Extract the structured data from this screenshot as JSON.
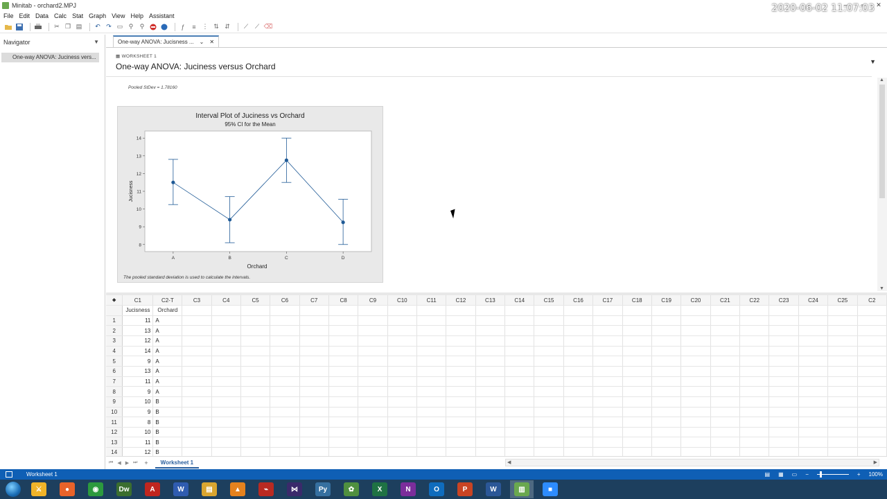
{
  "window": {
    "title": "Minitab - orchard2.MPJ",
    "minimize": "–",
    "restore": "▫",
    "close": "✕"
  },
  "menu": [
    "File",
    "Edit",
    "Data",
    "Calc",
    "Stat",
    "Graph",
    "View",
    "Help",
    "Assistant"
  ],
  "navigator": {
    "title": "Navigator",
    "items": [
      "One-way ANOVA: Juciness vers..."
    ]
  },
  "output_tab": {
    "label": "One-way ANOVA: Jucisness ...",
    "close": "✕"
  },
  "output": {
    "worksheet_label": "WORKSHEET 1",
    "title": "One-way ANOVA: Juciness versus Orchard",
    "pooled_stdev": "Pooled StDev = 1.78160",
    "graph_note": "The pooled standard deviation is used to calculate the intervals."
  },
  "chart_data": {
    "type": "line",
    "title": "Interval Plot of Juciness vs Orchard",
    "subtitle": "95% CI for the Mean",
    "xlabel": "Orchard",
    "ylabel": "Jucisness",
    "categories": [
      "A",
      "B",
      "C",
      "D"
    ],
    "means": [
      11.5,
      9.4,
      12.75,
      9.25
    ],
    "ci_lower": [
      10.25,
      8.1,
      11.5,
      8.0
    ],
    "ci_upper": [
      12.8,
      10.7,
      14.0,
      10.55
    ],
    "ylim": [
      7.6,
      14.4
    ],
    "yticks": [
      8,
      9,
      10,
      11,
      12,
      13,
      14
    ],
    "color": "#1f5a96"
  },
  "worksheet": {
    "columns": [
      "C1",
      "C2-T",
      "C3",
      "C4",
      "C5",
      "C6",
      "C7",
      "C8",
      "C9",
      "C10",
      "C11",
      "C12",
      "C13",
      "C14",
      "C15",
      "C16",
      "C17",
      "C18",
      "C19",
      "C20",
      "C21",
      "C22",
      "C23",
      "C24",
      "C25",
      "C2"
    ],
    "names": [
      "Jucisness",
      "Orchard"
    ],
    "rows": [
      [
        "1",
        "11",
        "A"
      ],
      [
        "2",
        "13",
        "A"
      ],
      [
        "3",
        "12",
        "A"
      ],
      [
        "4",
        "14",
        "A"
      ],
      [
        "5",
        "9",
        "A"
      ],
      [
        "6",
        "13",
        "A"
      ],
      [
        "7",
        "11",
        "A"
      ],
      [
        "8",
        "9",
        "A"
      ],
      [
        "9",
        "10",
        "B"
      ],
      [
        "10",
        "9",
        "B"
      ],
      [
        "11",
        "8",
        "B"
      ],
      [
        "12",
        "10",
        "B"
      ],
      [
        "13",
        "11",
        "B"
      ],
      [
        "14",
        "12",
        "B"
      ]
    ],
    "sheet_tab": "Worksheet 1",
    "add": "+"
  },
  "status": {
    "worksheet": "Worksheet 1",
    "zoom": "100%"
  },
  "clock": "2020-06-02 11:07:03",
  "taskbar_apps": [
    {
      "name": "sword-icon",
      "color": "#f0b429",
      "glyph": "⚔"
    },
    {
      "name": "firefox-icon",
      "color": "#e8632a",
      "glyph": "●"
    },
    {
      "name": "chrome-icon",
      "color": "#2c9a3e",
      "glyph": "◉"
    },
    {
      "name": "dreamweaver-icon",
      "color": "#3b6e2f",
      "glyph": "Dw"
    },
    {
      "name": "acrobat-icon",
      "color": "#c0261f",
      "glyph": "A"
    },
    {
      "name": "editor-icon",
      "color": "#2f5cb0",
      "glyph": "W"
    },
    {
      "name": "folder-icon",
      "color": "#d9a530",
      "glyph": "▤"
    },
    {
      "name": "vlc-icon",
      "color": "#e5821e",
      "glyph": "▲"
    },
    {
      "name": "pdf-icon",
      "color": "#b92a22",
      "glyph": "⌁"
    },
    {
      "name": "visual-studio-icon",
      "color": "#3a2a6b",
      "glyph": "⋈"
    },
    {
      "name": "python-icon",
      "color": "#3670a0",
      "glyph": "Py"
    },
    {
      "name": "tools-icon",
      "color": "#4f8f3f",
      "glyph": "✿"
    },
    {
      "name": "excel-icon",
      "color": "#1f7244",
      "glyph": "X"
    },
    {
      "name": "onenote-icon",
      "color": "#7b2e9b",
      "glyph": "N"
    },
    {
      "name": "outlook-icon",
      "color": "#0f6cbd",
      "glyph": "O"
    },
    {
      "name": "powerpoint-icon",
      "color": "#c94423",
      "glyph": "P"
    },
    {
      "name": "word-icon",
      "color": "#2b5797",
      "glyph": "W"
    },
    {
      "name": "minitab-icon",
      "color": "#6aa84f",
      "glyph": "▥"
    },
    {
      "name": "zoom-icon",
      "color": "#2d8cff",
      "glyph": "■"
    }
  ]
}
